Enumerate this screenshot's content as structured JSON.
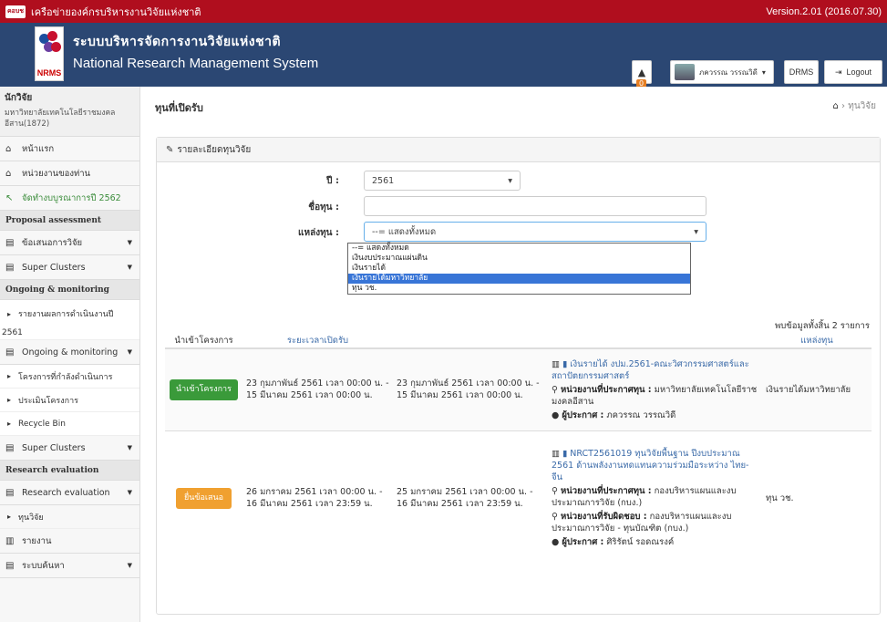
{
  "topbar": {
    "org": "เครือข่ายองค์กรบริหารงานวิจัยแห่งชาติ",
    "logo_text": "คอบช",
    "version": "Version.2.01 (2016.07.30)"
  },
  "header": {
    "logo_text": "NRMS",
    "title_th": "ระบบบริหารจัดการงานวิจัยแห่งชาติ",
    "title_en": "National Research Management System",
    "notification_count": "0",
    "user_name": "ภควรรณ วรรณวิดี",
    "drms": "DRMS",
    "logout": "Logout"
  },
  "sidebar": {
    "role": "นักวิจัย",
    "org": "มหาวิทยาลัยเทคโนโลยีราชมงคลอีสาน(1872)",
    "home": "หน้าแรก",
    "agency": "หน่วยงานของท่าน",
    "budget": "จัดทำงบบูรณาการปี 2562",
    "sec_proposal": "Proposal assessment",
    "proposal": "ข้อเสนอการวิจัย",
    "super1": "Super Clusters",
    "sec_ongoing": "Ongoing & monitoring",
    "report_progress": "รายงานผลการดำเนินงานปี",
    "report_year": "2561",
    "ongoing": "Ongoing & monitoring",
    "projects": "โครงการที่กำลังดำเนินการ",
    "evaluate": "ประเมินโครงการ",
    "recycle": "Recycle Bin",
    "super2": "Super Clusters",
    "sec_eval": "Research evaluation",
    "eval": "Research evaluation",
    "fund": "ทุนวิจัย",
    "report": "รายงาน",
    "search": "ระบบค้นหา"
  },
  "main": {
    "title": "ทุนที่เปิดรับ",
    "breadcrumb": "ทุนวิจัย",
    "panel_title": "รายละเอียดทุนวิจัย",
    "year_label": "ปี :",
    "year_value": "2561",
    "name_label": "ชื่อทุน :",
    "source_label": "แหล่งทุน :",
    "source_value": "--= แสดงทั้งหมด",
    "dropdown_options": [
      "--= แสดงทั้งหมด",
      "เงินงบประมาณแผ่นดิน",
      "เงินรายได้",
      "เงินรายได้มหาวิทยาลัย",
      "ทุน วช."
    ],
    "dropdown_selected_index": 3,
    "found": "พบข้อมูลทั้งสิ้น 2 รายการ",
    "columns": [
      "นำเข้าโครงการ",
      "ระยะเวลาเปิดรับ",
      "",
      "",
      "แหล่งทุน"
    ],
    "rows": [
      {
        "button": "นำเข้าโครงการ",
        "open": "23 กุมภาพันธ์ 2561 เวลา 00:00 น. - 15 มีนาคม 2561 เวลา 00:00 น.",
        "close": "23 กุมภาพันธ์ 2561 เวลา 00:00 น. - 15 มีนาคม 2561 เวลา 00:00 น.",
        "fund_name": "เงินรายได้ งปม.2561-คณะวิศวกรรมศาสตร์และสถาปัตยกรรมศาสตร์",
        "announcer_label": "หน่วยงานที่ประกาศทุน :",
        "announcer": "มหาวิทยาลัยเทคโนโลยีราชมงคลอีสาน",
        "poster_label": "ผู้ประกาศ :",
        "poster": "ภควรรณ วรรณวิดี",
        "source": "เงินรายได้มหาวิทยาลัย"
      },
      {
        "button": "ยื่นข้อเสนอ",
        "open": "26 มกราคม 2561 เวลา 00:00 น. - 16 มีนาคม 2561 เวลา 23:59 น.",
        "close": "25 มกราคม 2561 เวลา 00:00 น. - 16 มีนาคม 2561 เวลา 23:59 น.",
        "fund_name": "NRCT2561019 ทุนวิจัยพื้นฐาน ปีงบประมาณ 2561 ด้านพลังงานทดแทนความร่วมมือระหว่าง ไทย-จีน",
        "announcer_label": "หน่วยงานที่ประกาศทุน :",
        "announcer": "กองบริหารแผนและงบประมาณการวิจัย (กบง.)",
        "resp_label": "หน่วยงานที่รับผิดชอบ :",
        "resp": "กองบริหารแผนและงบประมาณการวิจัย - ทุนบัณฑิต (กบง.)",
        "poster_label": "ผู้ประกาศ :",
        "poster": "ศิริรัตน์ รอดณรงค์",
        "source": "ทุน วช."
      }
    ]
  },
  "colors": {
    "topbar": "#b00e1e",
    "header": "#2b4773",
    "accent_green": "#3a9a3a",
    "accent_orange": "#f0a030",
    "link": "#3a6aa8"
  }
}
